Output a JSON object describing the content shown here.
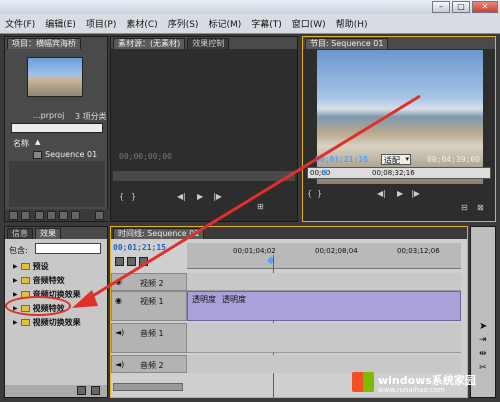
{
  "menubar": {
    "items": [
      "文件(F)",
      "编辑(E)",
      "项目(P)",
      "素材(C)",
      "序列(S)",
      "标记(M)",
      "字幕(T)",
      "窗口(W)",
      "帮助(H)"
    ]
  },
  "project_panel": {
    "tab": "项目：横幅宾海桥",
    "project_file": "...prproj",
    "item_count": "3 项分类",
    "name_header": "名称",
    "sequence_item": "Sequence 01"
  },
  "source_monitor": {
    "tabs": [
      "素材源：(无素材)",
      "效果控制"
    ],
    "timecode": "00;00;00;00"
  },
  "program_monitor": {
    "tab": "节目: Sequence 01",
    "timecode": "00;01;21;15",
    "fit": "适配",
    "duration": "00;04;39;00",
    "ruler_start": "00;00",
    "ruler_mark": "00;08;32;16"
  },
  "effects_panel": {
    "tabs": [
      "信息",
      "效果"
    ],
    "contains_label": "包含:",
    "folders": [
      "预设",
      "音频特效",
      "音频切换效果",
      "视频特效",
      "视频切换效果"
    ]
  },
  "timeline": {
    "tab": "时间线: Sequence 01",
    "timecode": "00;01;21;15",
    "ruler_labels": [
      "00;01;04;02",
      "00;02;08;04",
      "00;03;12;06"
    ],
    "tracks": {
      "video2": "视频 2",
      "video1": "视频 1",
      "audio1": "音频 1",
      "audio2": "音频 2"
    },
    "opacity_label": "透明度",
    "opacity_value": "透明度"
  },
  "watermark": {
    "brand": "windows系统家园",
    "url": "www.runaihao.com"
  },
  "colors": {
    "timecode_blue": "#4da3ff",
    "arrow_red": "#e0302a",
    "playhead_red": "#d83030",
    "folder_yellow": "#e0c040",
    "panel_border_gold": "#e0b020",
    "clip_purple": "#a8a2d8"
  }
}
